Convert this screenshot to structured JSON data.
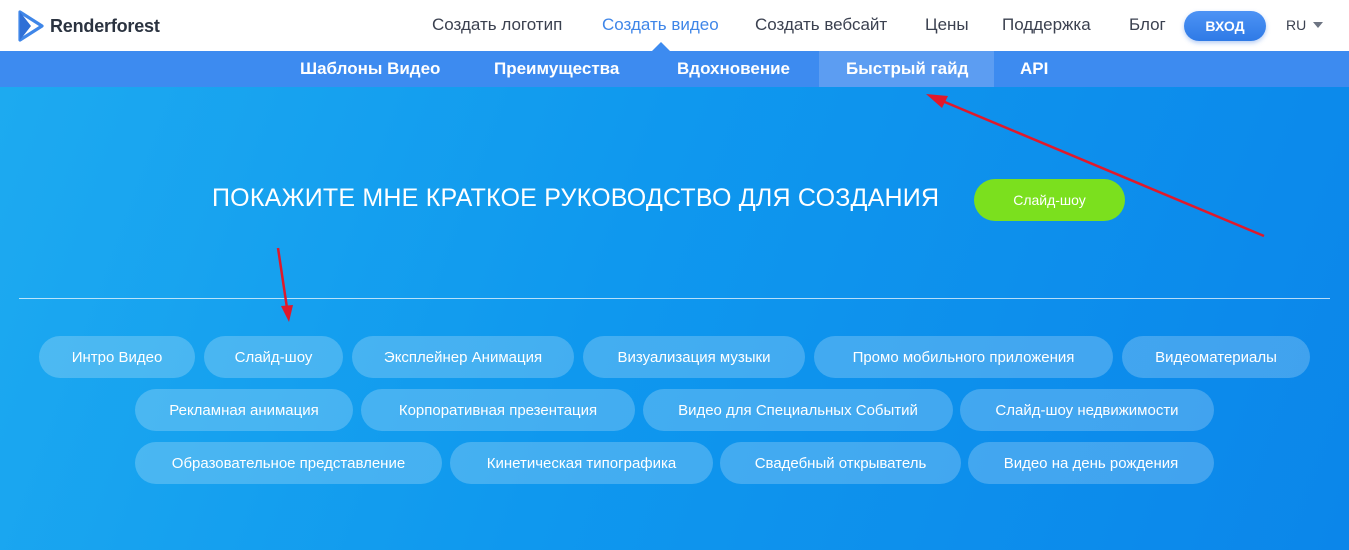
{
  "brand": {
    "name": "Renderforest",
    "logo_color": "#3f86e8"
  },
  "header": {
    "nav": [
      "Создать логотип",
      "Создать видео",
      "Создать вебсайт",
      "Цены",
      "Поддержка",
      "Блог"
    ],
    "active_nav": "Создать видео",
    "login_label": "ВХОД",
    "language": "RU"
  },
  "subnav": {
    "items": [
      "Шаблоны Видео",
      "Преимущества",
      "Вдохновение",
      "Быстрый гайд",
      "API"
    ],
    "active": "Быстрый гайд"
  },
  "hero": {
    "headline": "ПОКАЖИТЕ МНЕ КРАТКОЕ РУКОВОДСТВО ДЛЯ СОЗДАНИЯ",
    "cta_label": "Слайд-шоу",
    "cta_color": "#7be01e"
  },
  "categories": {
    "row1": [
      "Интро Видео",
      "Слайд-шоу",
      "Эксплейнер Анимация",
      "Визуализация музыки",
      "Промо мобильного приложения",
      "Видеоматериалы"
    ],
    "row2": [
      "Рекламная анимация",
      "Корпоративная презентация",
      "Видео для Специальных Событий",
      "Слайд-шоу недвижимости"
    ],
    "row3": [
      "Образовательное представление",
      "Кинетическая типографика",
      "Свадебный открыватель",
      "Видео на день рождения"
    ]
  },
  "annotation_color": "#e0192b"
}
